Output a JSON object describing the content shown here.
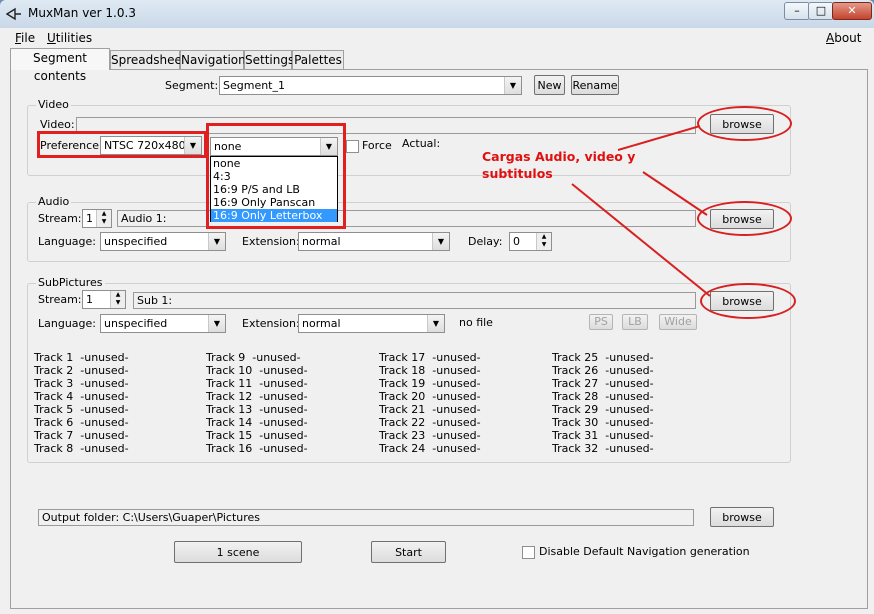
{
  "window": {
    "title": "MuxMan ver 1.0.3",
    "min": "–",
    "max": "□",
    "close": "✕"
  },
  "menu": {
    "file": "File",
    "utilities": "Utilities",
    "about": "About"
  },
  "tabs": [
    "Segment contents",
    "Spreadsheet",
    "Navigation",
    "Settings",
    "Palettes"
  ],
  "segment": {
    "label": "Segment:",
    "value": "Segment_1",
    "new_label": "New",
    "rename_label": "Rename"
  },
  "video": {
    "group_title": "Video",
    "file_label": "Video:",
    "preference_label": "Preference:",
    "preference_value": "NTSC 720x480",
    "mode_value": "none",
    "mode_options": [
      "none",
      "4:3",
      "16:9 P/S and LB",
      "16:9 Only Panscan",
      "16:9 Only Letterbox"
    ],
    "mode_selected_index": 4,
    "force_label": "Force",
    "actual_label": "Actual:",
    "browse_label": "browse"
  },
  "audio": {
    "group_title": "Audio",
    "stream_label": "Stream:",
    "stream_value": "1",
    "file_label": "Audio 1:",
    "language_label": "Language:",
    "language_value": "unspecified",
    "extension_label": "Extension:",
    "extension_value": "normal",
    "delay_label": "Delay:",
    "delay_value": "0",
    "browse_label": "browse"
  },
  "subpictures": {
    "group_title": "SubPictures",
    "stream_label": "Stream:",
    "stream_value": "1",
    "file_label": "Sub 1:",
    "language_label": "Language:",
    "language_value": "unspecified",
    "extension_label": "Extension:",
    "extension_value": "normal",
    "status": "no file",
    "ps_label": "PS",
    "lb_label": "LB",
    "wide_label": "Wide",
    "browse_label": "browse",
    "tracks": [
      [
        "Track 1  -unused-",
        "Track 2  -unused-",
        "Track 3  -unused-",
        "Track 4  -unused-",
        "Track 5  -unused-",
        "Track 6  -unused-",
        "Track 7  -unused-",
        "Track 8  -unused-"
      ],
      [
        "Track 9  -unused-",
        "Track 10  -unused-",
        "Track 11  -unused-",
        "Track 12  -unused-",
        "Track 13  -unused-",
        "Track 14  -unused-",
        "Track 15  -unused-",
        "Track 16  -unused-"
      ],
      [
        "Track 17  -unused-",
        "Track 18  -unused-",
        "Track 19  -unused-",
        "Track 20  -unused-",
        "Track 21  -unused-",
        "Track 22  -unused-",
        "Track 23  -unused-",
        "Track 24  -unused-"
      ],
      [
        "Track 25  -unused-",
        "Track 26  -unused-",
        "Track 27  -unused-",
        "Track 28  -unused-",
        "Track 29  -unused-",
        "Track 30  -unused-",
        "Track 31  -unused-",
        "Track 32  -unused-"
      ]
    ]
  },
  "output": {
    "label": "Output folder: C:\\Users\\Guaper\\Pictures",
    "browse_label": "browse"
  },
  "bottom": {
    "scene_label": "1 scene",
    "start_label": "Start",
    "disable_nav_label": "Disable Default Navigation generation"
  },
  "annotation": {
    "text": "Cargas Audio, video y subtitulos",
    "color": "#e01010"
  }
}
